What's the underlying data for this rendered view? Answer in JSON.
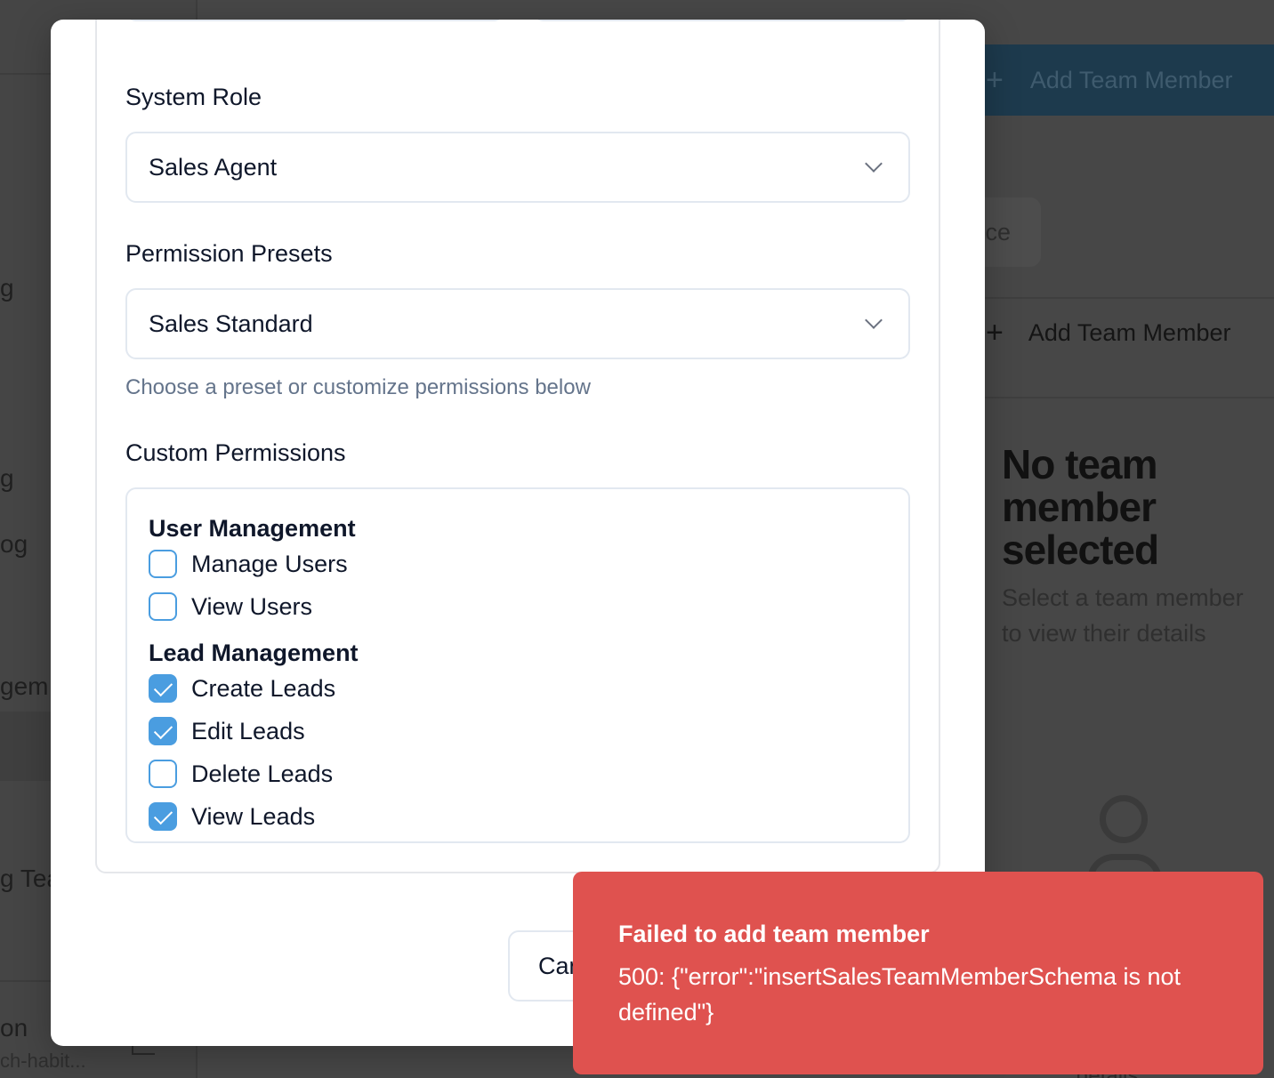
{
  "background": {
    "sidebar_items": [
      "g",
      "g",
      "og",
      "gem",
      "g Tea",
      "on"
    ],
    "sidebar_footer_sub": "ch-habit...",
    "header_button": {
      "label": "Add Team Member",
      "icon": "plus-icon"
    },
    "tab_fragment": "ce",
    "add_button": {
      "label": "Add Team Member",
      "icon": "plus-icon"
    },
    "empty_state": {
      "title": "No team member selected",
      "subtitle": "Select a team member to view their details",
      "icon": "user-icon",
      "footer_fragment": "details"
    }
  },
  "modal": {
    "system_role": {
      "label": "System Role",
      "value": "Sales Agent"
    },
    "permission_presets": {
      "label": "Permission Presets",
      "value": "Sales Standard",
      "hint": "Choose a preset or customize permissions below"
    },
    "custom_permissions": {
      "label": "Custom Permissions",
      "groups": [
        {
          "title": "User Management",
          "items": [
            {
              "label": "Manage Users",
              "checked": false
            },
            {
              "label": "View Users",
              "checked": false
            }
          ]
        },
        {
          "title": "Lead Management",
          "items": [
            {
              "label": "Create Leads",
              "checked": true
            },
            {
              "label": "Edit Leads",
              "checked": true
            },
            {
              "label": "Delete Leads",
              "checked": false
            },
            {
              "label": "View Leads",
              "checked": true
            }
          ]
        }
      ]
    },
    "cancel_button": "Cancel"
  },
  "toast": {
    "title": "Failed to add team member",
    "message": "500: {\"error\":\"insertSalesTeamMemberSchema is not defined\"}",
    "color": "#df524f"
  },
  "colors": {
    "accent": "#4a9de0",
    "overlay": "#474747"
  }
}
